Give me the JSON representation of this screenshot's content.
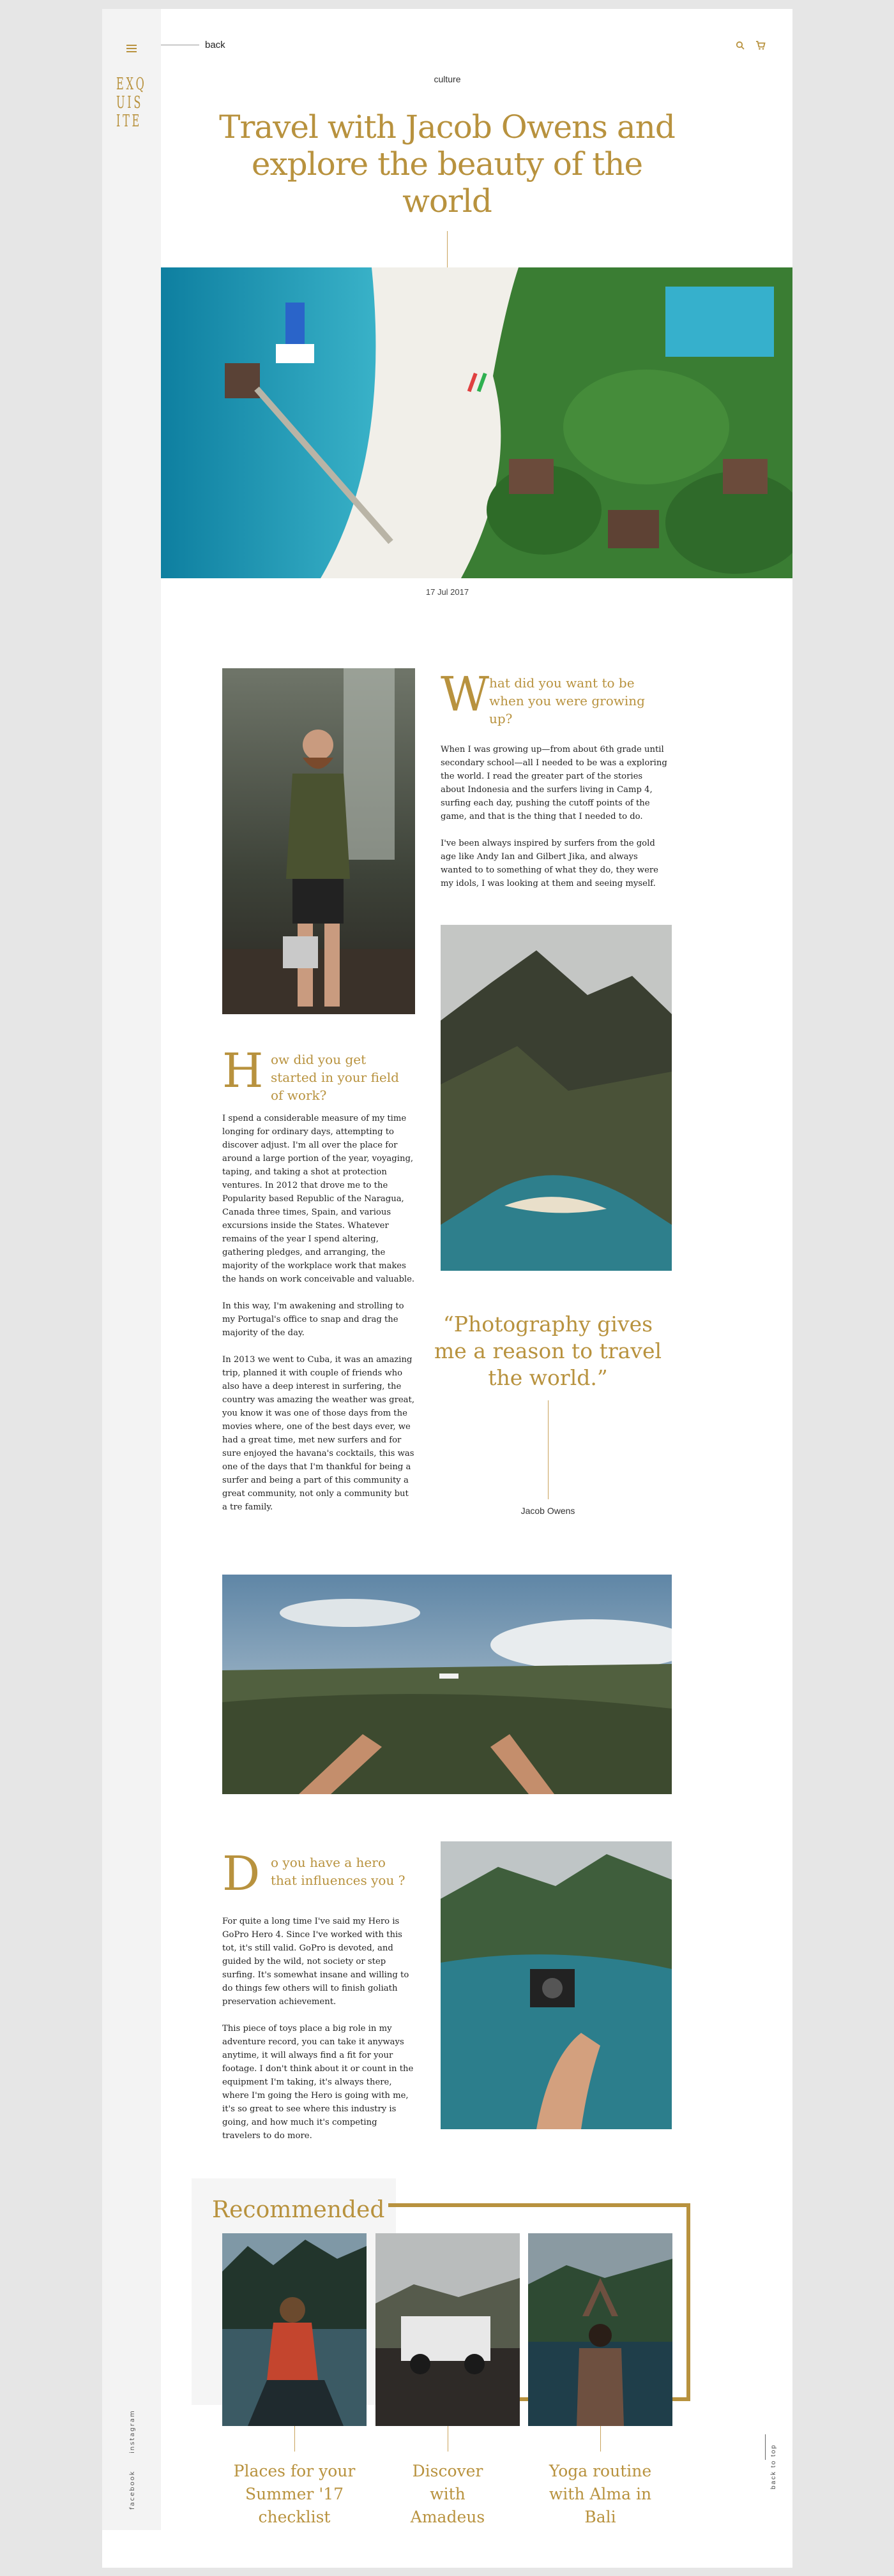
{
  "nav": {
    "back_label": "back",
    "logo_lines": [
      "EXQ",
      "UIS",
      "ITE"
    ],
    "social": [
      "facebook",
      "instagram"
    ]
  },
  "article": {
    "category": "culture",
    "title": "Travel with Jacob Owens and explore the beauty of the world",
    "date": "17 Jul 2017"
  },
  "sections": [
    {
      "dropcap": "W",
      "question": "hat did you want to be when you were growing up?",
      "paragraphs": [
        "When I was growing up—from about 6th grade until secondary school—all I needed to be was a exploring the world. I read the greater part of the stories about Indonesia and the surfers living in Camp 4,  surfing each day, pushing the cutoff points of the game, and that is the thing that I needed to do.",
        "I've been always inspired by surfers from the gold age like Andy Ian and Gilbert Jika, and always wanted to to something of what they do, they were my idols, I was looking at them and seeing myself."
      ]
    },
    {
      "dropcap": "H",
      "question": "ow did you get started in your field of work?",
      "paragraphs": [
        "I spend a considerable measure of my time longing for ordinary days, attempting to discover adjust. I'm all over the place for around a large portion of the year, voyaging, taping, and taking a shot at protection ventures. In 2012 that drove me to the Popularity based Republic of the Naragua, Canada three times, Spain, and various excursions inside the States. Whatever remains of the year I spend altering, gathering pledges, and arranging, the majority of the workplace work that makes the hands on work conceivable and valuable.",
        "In this way,  I'm awakening and strolling to my Portugal's office to snap and drag the majority of the day.",
        "In 2013 we went to Cuba, it was an amazing trip, planned it with couple of friends who also have a deep interest in surfering, the country was amazing the weather was great, you know it was one of those days from the movies where, one of the best days ever, we had a great time, met new surfers and for sure enjoyed the havana's cocktails, this was one of the days that I'm thankful for being a surfer and being a part of this community a great community, not only a community but a tre family."
      ]
    },
    {
      "dropcap": "D",
      "question": "o you have a hero that influences you ?",
      "paragraphs": [
        "For quite a long time I've said my Hero is GoPro Hero 4. Since I've worked with this tot, it's still valid. GoPro is devoted, and guided by the wild, not society or step surfing. It's somewhat insane and willing to do things few others will to finish goliath preservation achievement.",
        "This piece of toys place a big role in my adventure record, you can take it anyways anytime, it will always find a fit for your footage. I don't think about it or count in the equipment I'm taking, it's always there, where I'm going the Hero is going with me, it's so great to see where this industry is going, and how much it's competing travelers to do more."
      ]
    }
  ],
  "pullquote": {
    "text": "“Photography gives me a reason to travel the world.”",
    "author": "Jacob Owens"
  },
  "recommended": {
    "title": "Recommended",
    "items": [
      {
        "title": "Places for your Summer '17 checklist"
      },
      {
        "title": "Discover with Amadeus"
      },
      {
        "title": "Yoga routine with Alma in Bali"
      }
    ]
  },
  "footer": {
    "back_to_top": "back to top"
  },
  "colors": {
    "accent": "#b8923e",
    "rail": "#f3f3f3",
    "page_bg": "#e6e6e6"
  }
}
